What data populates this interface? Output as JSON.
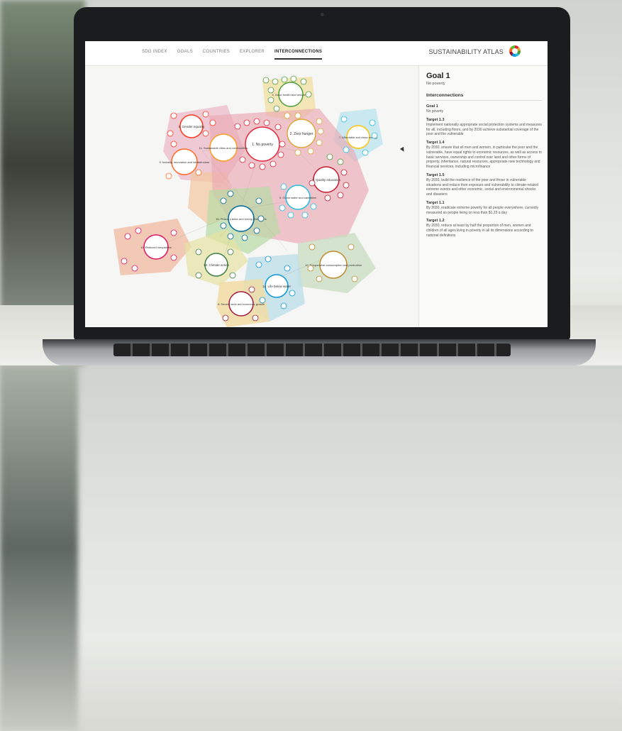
{
  "nav": {
    "items": [
      "SDG INDEX",
      "GOALS",
      "COUNTRIES",
      "EXPLORER",
      "INTERCONNECTIONS"
    ],
    "active_index": 4
  },
  "brand": {
    "title": "SUSTAINABILITY ATLAS"
  },
  "panel": {
    "goal_title": "Goal 1",
    "goal_subtitle": "No poverty",
    "section_title": "Interconnections",
    "entries": [
      {
        "title": "Goal 1",
        "text": "No poverty"
      },
      {
        "title": "Target 1.3",
        "text": "Implement nationally appropriate social protection systems and measures for all, including floors, and by 2030 achieve substantial coverage of the poor and the vulnerable"
      },
      {
        "title": "Target 1.4",
        "text": "By 2030, ensure that all men and women, in particular the poor and the vulnerable, have equal rights to economic resources, as well as access to basic services, ownership and control over land and other forms of property, inheritance, natural resources, appropriate new technology and financial services, including microfinance"
      },
      {
        "title": "Target 1.5",
        "text": "By 2030, build the resilience of the poor and those in vulnerable situations and reduce their exposure and vulnerability to climate-related extreme events and other economic, social and environmental shocks and disasters"
      },
      {
        "title": "Target 1.1",
        "text": "By 2030, eradicate extreme poverty for all people everywhere, currently measured as people living on less than $1.25 a day"
      },
      {
        "title": "Target 1.2",
        "text": "By 2030, reduce at least by half the proportion of men, women and children of all ages living in poverty in all its dimensions according to national definitions"
      }
    ]
  },
  "viz": {
    "goals": [
      {
        "label": "1. No poverty",
        "color": "#e5243b"
      },
      {
        "label": "2. Zero hunger",
        "color": "#dda63a"
      },
      {
        "label": "3. Good health and well-being",
        "color": "#4c9f38"
      },
      {
        "label": "4. Quality education",
        "color": "#c5192d"
      },
      {
        "label": "5. Gender equality",
        "color": "#ff3a21"
      },
      {
        "label": "6. Clean water and sanitation",
        "color": "#26bde2"
      },
      {
        "label": "7. Affordable and clean energy",
        "color": "#fcc30b"
      },
      {
        "label": "8. Decent work and economic growth",
        "color": "#a21942"
      },
      {
        "label": "9. Industry, innovation and infrastructure",
        "color": "#fd6925"
      },
      {
        "label": "10. Reduced inequalities",
        "color": "#dd1367"
      },
      {
        "label": "11. Sustainable cities and communities",
        "color": "#fd9d24"
      },
      {
        "label": "12. Responsible consumption and production",
        "color": "#bf8b2e"
      },
      {
        "label": "13. Climate action",
        "color": "#3f7e44"
      },
      {
        "label": "14. Life below water",
        "color": "#0a97d9"
      },
      {
        "label": "16. Peace, justice and strong institutions",
        "color": "#00689d"
      }
    ]
  }
}
